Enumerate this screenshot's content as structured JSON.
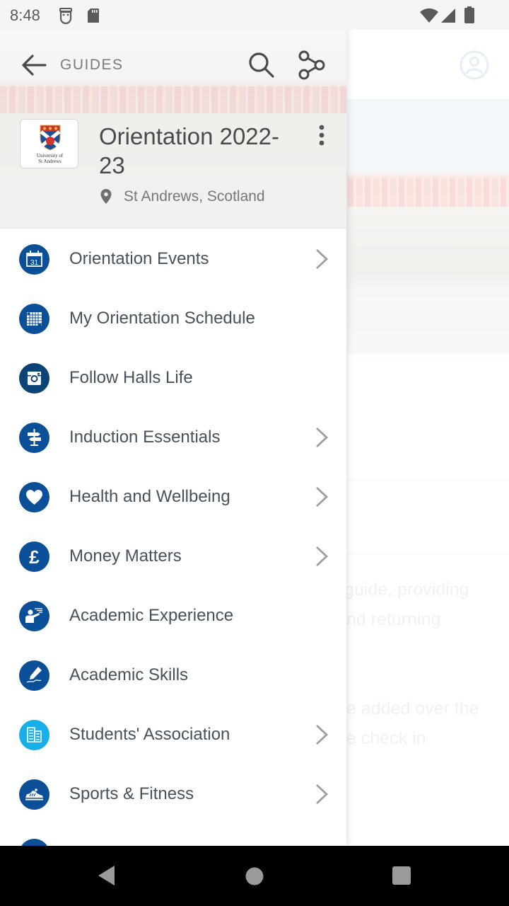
{
  "status_bar": {
    "time": "8:48",
    "left_icons": [
      "notification-app-icon",
      "sd-card-icon"
    ],
    "right_icons": [
      "wifi-icon",
      "cell-signal-icon",
      "battery-icon"
    ]
  },
  "drawer": {
    "header": {
      "back_icon": "arrow-left-icon",
      "section_label": "GUIDES",
      "search_icon": "search-icon",
      "share_icon": "share-icon",
      "logo_caption_line1": "University of",
      "logo_caption_line2": "St Andrews",
      "title": "Orientation 2022-23",
      "more_icon": "more-vertical-icon",
      "location_icon": "map-pin-icon",
      "location": "St Andrews, Scotland"
    },
    "items": [
      {
        "label": "Orientation Events",
        "icon": "calendar-31-icon",
        "has_chevron": true
      },
      {
        "label": "My Orientation Schedule",
        "icon": "calendar-grid-icon",
        "has_chevron": false
      },
      {
        "label": "Follow Halls Life",
        "icon": "instagram-icon",
        "has_chevron": false
      },
      {
        "label": "Induction Essentials",
        "icon": "signpost-icon",
        "has_chevron": true
      },
      {
        "label": "Health and Wellbeing",
        "icon": "heart-icon",
        "has_chevron": true
      },
      {
        "label": "Money Matters",
        "icon": "pound-icon",
        "has_chevron": true
      },
      {
        "label": "Academic Experience",
        "icon": "presenter-icon",
        "has_chevron": false
      },
      {
        "label": "Academic Skills",
        "icon": "pen-writing-icon",
        "has_chevron": false
      },
      {
        "label": "Students' Association",
        "icon": "building-icon",
        "has_chevron": true
      },
      {
        "label": "Sports & Fitness",
        "icon": "sneaker-icon",
        "has_chevron": true
      }
    ]
  },
  "background": {
    "profile_icon": "profile-icon",
    "text_lines": [
      "guide, providing",
      "nd returning",
      "e added over the",
      "e check in"
    ]
  },
  "colors": {
    "icon_dark_blue": "#0a4f97",
    "icon_light_blue": "#17aee9",
    "label_text": "#46525b",
    "chevron": "#9aa0a4"
  },
  "nav_bar": {
    "back": "nav-back-icon",
    "home": "nav-home-icon",
    "recents": "nav-recents-icon"
  }
}
